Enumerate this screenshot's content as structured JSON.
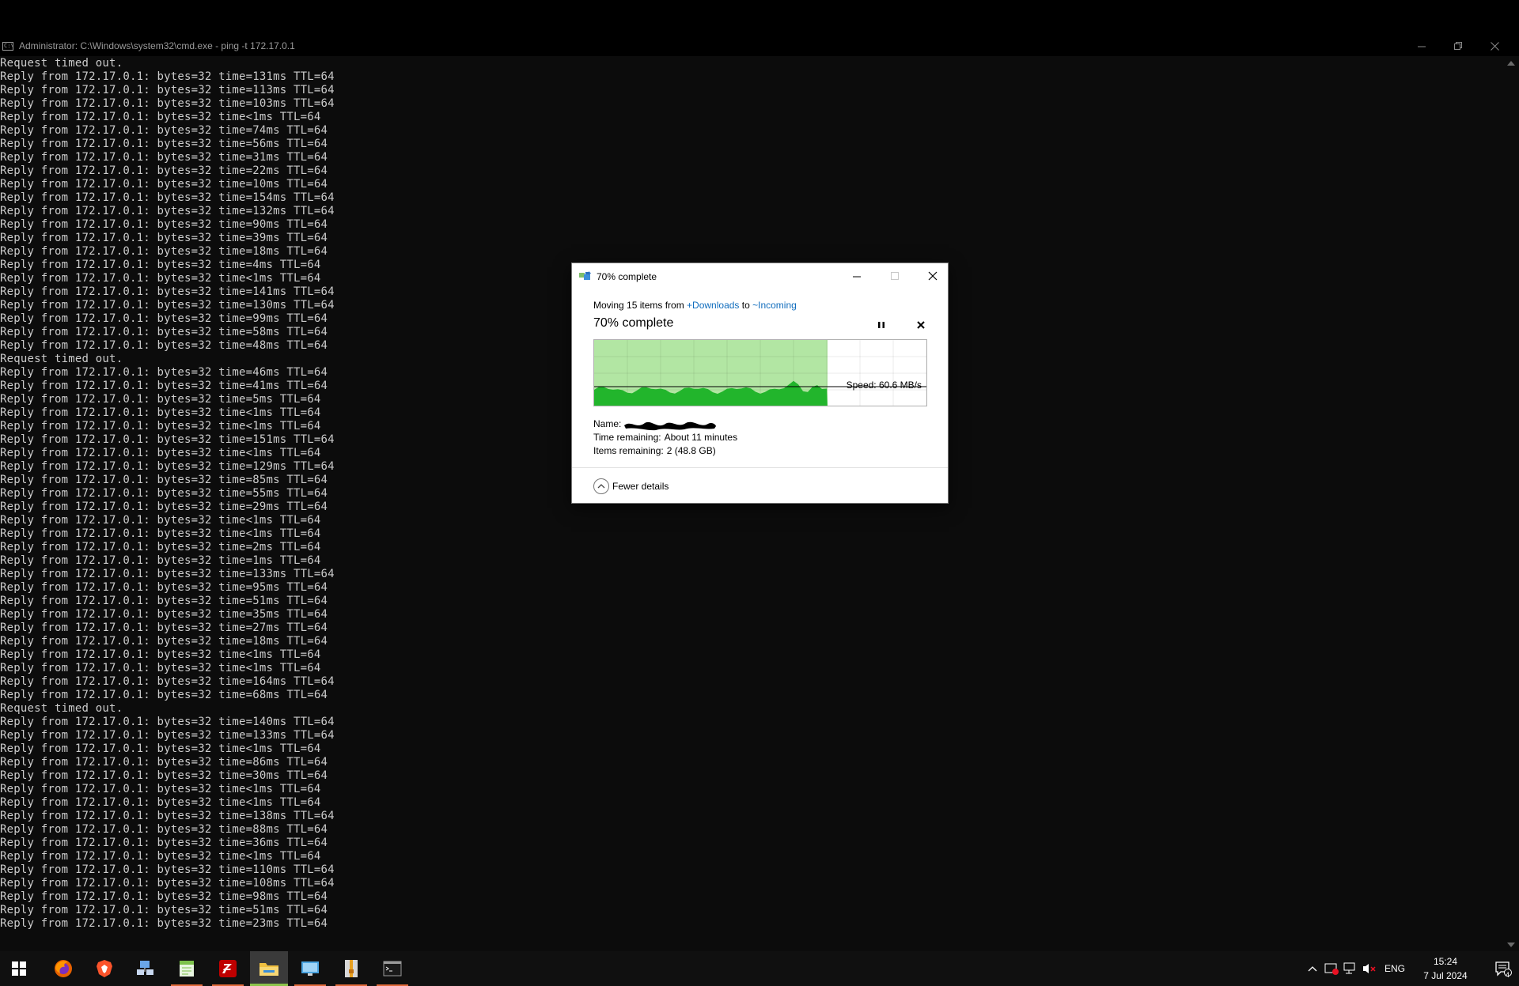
{
  "cmd": {
    "title": "Administrator: C:\\Windows\\system32\\cmd.exe - ping  -t 172.17.0.1",
    "icon": "cmd-icon",
    "icon_text": "C:\\",
    "lines": [
      "Request timed out.",
      "Reply from 172.17.0.1: bytes=32 time=131ms TTL=64",
      "Reply from 172.17.0.1: bytes=32 time=113ms TTL=64",
      "Reply from 172.17.0.1: bytes=32 time=103ms TTL=64",
      "Reply from 172.17.0.1: bytes=32 time<1ms TTL=64",
      "Reply from 172.17.0.1: bytes=32 time=74ms TTL=64",
      "Reply from 172.17.0.1: bytes=32 time=56ms TTL=64",
      "Reply from 172.17.0.1: bytes=32 time=31ms TTL=64",
      "Reply from 172.17.0.1: bytes=32 time=22ms TTL=64",
      "Reply from 172.17.0.1: bytes=32 time=10ms TTL=64",
      "Reply from 172.17.0.1: bytes=32 time=154ms TTL=64",
      "Reply from 172.17.0.1: bytes=32 time=132ms TTL=64",
      "Reply from 172.17.0.1: bytes=32 time=90ms TTL=64",
      "Reply from 172.17.0.1: bytes=32 time=39ms TTL=64",
      "Reply from 172.17.0.1: bytes=32 time=18ms TTL=64",
      "Reply from 172.17.0.1: bytes=32 time=4ms TTL=64",
      "Reply from 172.17.0.1: bytes=32 time<1ms TTL=64",
      "Reply from 172.17.0.1: bytes=32 time=141ms TTL=64",
      "Reply from 172.17.0.1: bytes=32 time=130ms TTL=64",
      "Reply from 172.17.0.1: bytes=32 time=99ms TTL=64",
      "Reply from 172.17.0.1: bytes=32 time=58ms TTL=64",
      "Reply from 172.17.0.1: bytes=32 time=48ms TTL=64",
      "Request timed out.",
      "Reply from 172.17.0.1: bytes=32 time=46ms TTL=64",
      "Reply from 172.17.0.1: bytes=32 time=41ms TTL=64",
      "Reply from 172.17.0.1: bytes=32 time=5ms TTL=64",
      "Reply from 172.17.0.1: bytes=32 time<1ms TTL=64",
      "Reply from 172.17.0.1: bytes=32 time<1ms TTL=64",
      "Reply from 172.17.0.1: bytes=32 time=151ms TTL=64",
      "Reply from 172.17.0.1: bytes=32 time<1ms TTL=64",
      "Reply from 172.17.0.1: bytes=32 time=129ms TTL=64",
      "Reply from 172.17.0.1: bytes=32 time=85ms TTL=64",
      "Reply from 172.17.0.1: bytes=32 time=55ms TTL=64",
      "Reply from 172.17.0.1: bytes=32 time=29ms TTL=64",
      "Reply from 172.17.0.1: bytes=32 time<1ms TTL=64",
      "Reply from 172.17.0.1: bytes=32 time<1ms TTL=64",
      "Reply from 172.17.0.1: bytes=32 time=2ms TTL=64",
      "Reply from 172.17.0.1: bytes=32 time=1ms TTL=64",
      "Reply from 172.17.0.1: bytes=32 time=133ms TTL=64",
      "Reply from 172.17.0.1: bytes=32 time=95ms TTL=64",
      "Reply from 172.17.0.1: bytes=32 time=51ms TTL=64",
      "Reply from 172.17.0.1: bytes=32 time=35ms TTL=64",
      "Reply from 172.17.0.1: bytes=32 time=27ms TTL=64",
      "Reply from 172.17.0.1: bytes=32 time=18ms TTL=64",
      "Reply from 172.17.0.1: bytes=32 time<1ms TTL=64",
      "Reply from 172.17.0.1: bytes=32 time<1ms TTL=64",
      "Reply from 172.17.0.1: bytes=32 time=164ms TTL=64",
      "Reply from 172.17.0.1: bytes=32 time=68ms TTL=64",
      "Request timed out.",
      "Reply from 172.17.0.1: bytes=32 time=140ms TTL=64",
      "Reply from 172.17.0.1: bytes=32 time=133ms TTL=64",
      "Reply from 172.17.0.1: bytes=32 time<1ms TTL=64",
      "Reply from 172.17.0.1: bytes=32 time=86ms TTL=64",
      "Reply from 172.17.0.1: bytes=32 time=30ms TTL=64",
      "Reply from 172.17.0.1: bytes=32 time<1ms TTL=64",
      "Reply from 172.17.0.1: bytes=32 time<1ms TTL=64",
      "Reply from 172.17.0.1: bytes=32 time=138ms TTL=64",
      "Reply from 172.17.0.1: bytes=32 time=88ms TTL=64",
      "Reply from 172.17.0.1: bytes=32 time=36ms TTL=64",
      "Reply from 172.17.0.1: bytes=32 time<1ms TTL=64",
      "Reply from 172.17.0.1: bytes=32 time=110ms TTL=64",
      "Reply from 172.17.0.1: bytes=32 time=108ms TTL=64",
      "Reply from 172.17.0.1: bytes=32 time=98ms TTL=64",
      "Reply from 172.17.0.1: bytes=32 time=51ms TTL=64",
      "Reply from 172.17.0.1: bytes=32 time=23ms TTL=64"
    ],
    "colors": {
      "background": "#0c0c0c",
      "text": "#cccccc"
    }
  },
  "copy_dialog": {
    "title": "70% complete",
    "icon": "file-move-icon",
    "moving_prefix": "Moving 15 items from ",
    "source": "+Downloads",
    "to_word": " to ",
    "destination": "~Incoming",
    "progress_heading": "70% complete",
    "progress_fraction": 0.7,
    "speed_label": "Speed: 60.6 MB/s",
    "details": {
      "name_label": "Name:",
      "name_value_redacted": true,
      "time_label": "Time remaining:",
      "time_value": "About 11 minutes",
      "items_label": "Items remaining:",
      "items_value": "2 (48.8 GB)"
    },
    "fewer_details_label": "Fewer details",
    "colors": {
      "graph_fill_light": "#b2e6a3",
      "graph_fill_dark": "#22b52c",
      "link": "#0f6cbd"
    }
  },
  "taskbar": {
    "apps": [
      {
        "name": "start-button",
        "icon": "windows-logo-icon"
      },
      {
        "name": "firefox",
        "icon": "firefox-icon"
      },
      {
        "name": "brave",
        "icon": "brave-icon"
      },
      {
        "name": "network-tool",
        "icon": "network-share-icon"
      },
      {
        "name": "notepad-plus",
        "icon": "notepad-icon",
        "running": true
      },
      {
        "name": "filezilla",
        "icon": "filezilla-icon",
        "running": true
      },
      {
        "name": "file-explorer",
        "icon": "folder-icon",
        "running": true,
        "active": true
      },
      {
        "name": "remote-desktop",
        "icon": "remote-desktop-icon",
        "running": true
      },
      {
        "name": "archive-tool",
        "icon": "archive-icon",
        "running": true
      },
      {
        "name": "terminal",
        "icon": "terminal-icon",
        "running": true
      }
    ],
    "tray": {
      "language": "ENG",
      "time": "15:24",
      "date": "7 Jul 2024",
      "notification_count": "4"
    }
  }
}
